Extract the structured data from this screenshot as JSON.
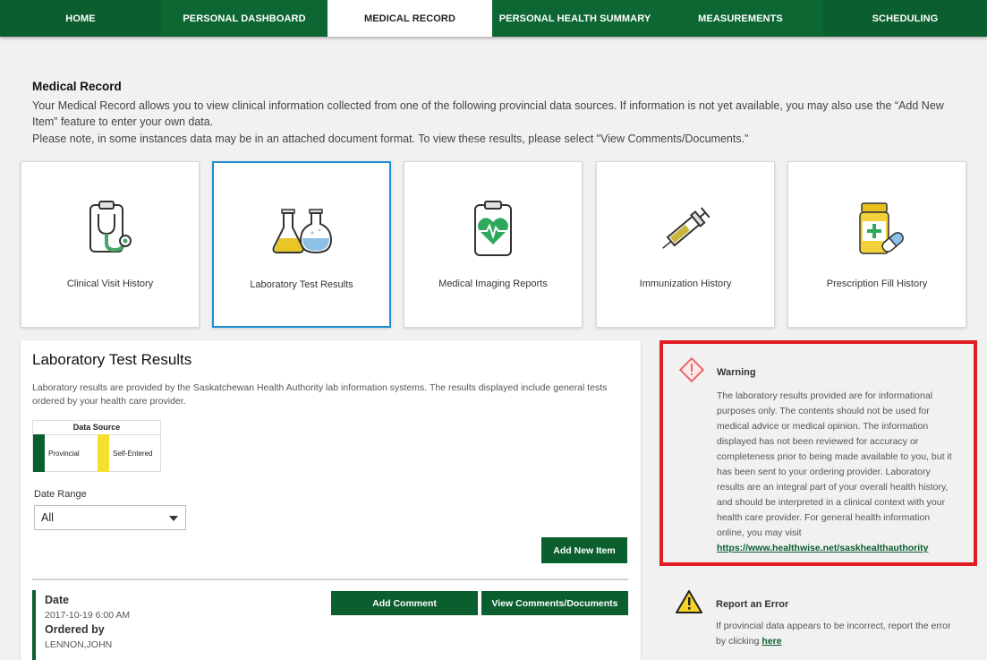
{
  "nav": {
    "items": [
      "HOME",
      "PERSONAL DASHBOARD",
      "MEDICAL RECORD",
      "PERSONAL HEALTH SUMMARY",
      "MEASUREMENTS",
      "SCHEDULING"
    ],
    "active": "MEDICAL RECORD"
  },
  "intro": {
    "title": "Medical Record",
    "line1": "Your Medical Record allows you to view clinical information collected from one of the following provincial data sources. If information is not yet available, you may also use the “Add New Item” feature to enter your own data.",
    "line2": "Please note, in some instances data may be in an attached document format. To view these results, please select \"View Comments/Documents.\""
  },
  "cards": [
    {
      "label": "Clinical Visit History",
      "icon": "clipboard-stethoscope-icon"
    },
    {
      "label": "Laboratory Test Results",
      "icon": "lab-flasks-icon",
      "selected": true
    },
    {
      "label": "Medical Imaging Reports",
      "icon": "clipboard-heart-icon"
    },
    {
      "label": "Immunization History",
      "icon": "syringe-icon"
    },
    {
      "label": "Prescription Fill History",
      "icon": "pill-bottle-icon"
    }
  ],
  "lab": {
    "title": "Laboratory Test Results",
    "description": "Laboratory results are provided by the Saskatchewan Health Authority lab information systems. The results displayed include general tests ordered by your health care provider.",
    "data_source": {
      "title": "Data Source",
      "provincial": "Provincial",
      "self_entered": "Self-Entered"
    },
    "date_range": {
      "label": "Date Range",
      "value": "All"
    },
    "add_new_item": "Add New Item",
    "add_comment": "Add Comment",
    "view_comments": "View Comments/Documents",
    "record": {
      "date_label": "Date",
      "date_value": "2017-10-19 6:00 AM",
      "ordered_by_label": "Ordered by",
      "ordered_by_value": "LENNON,JOHN"
    }
  },
  "warning": {
    "title": "Warning",
    "text": "The laboratory results provided are for informational purposes only. The contents should not be used for medical advice or medical opinion. The information displayed has not been reviewed for accuracy or completeness prior to being made available to you, but it has been sent to your ordering provider. Laboratory results are an integral part of your overall health history, and should be interpreted in a clinical context with your health care provider. For general health information online, you may visit",
    "link": "https://www.healthwise.net/saskhealthauthority"
  },
  "report": {
    "title": "Report an Error",
    "text": "If provincial data appears to be incorrect, report the error by clicking",
    "link": "here"
  },
  "colors": {
    "brand_green": "#0b5e2e",
    "selected_border": "#1e8ecf",
    "warning_red": "#e31b23",
    "self_entered_yellow": "#f5e12d"
  }
}
